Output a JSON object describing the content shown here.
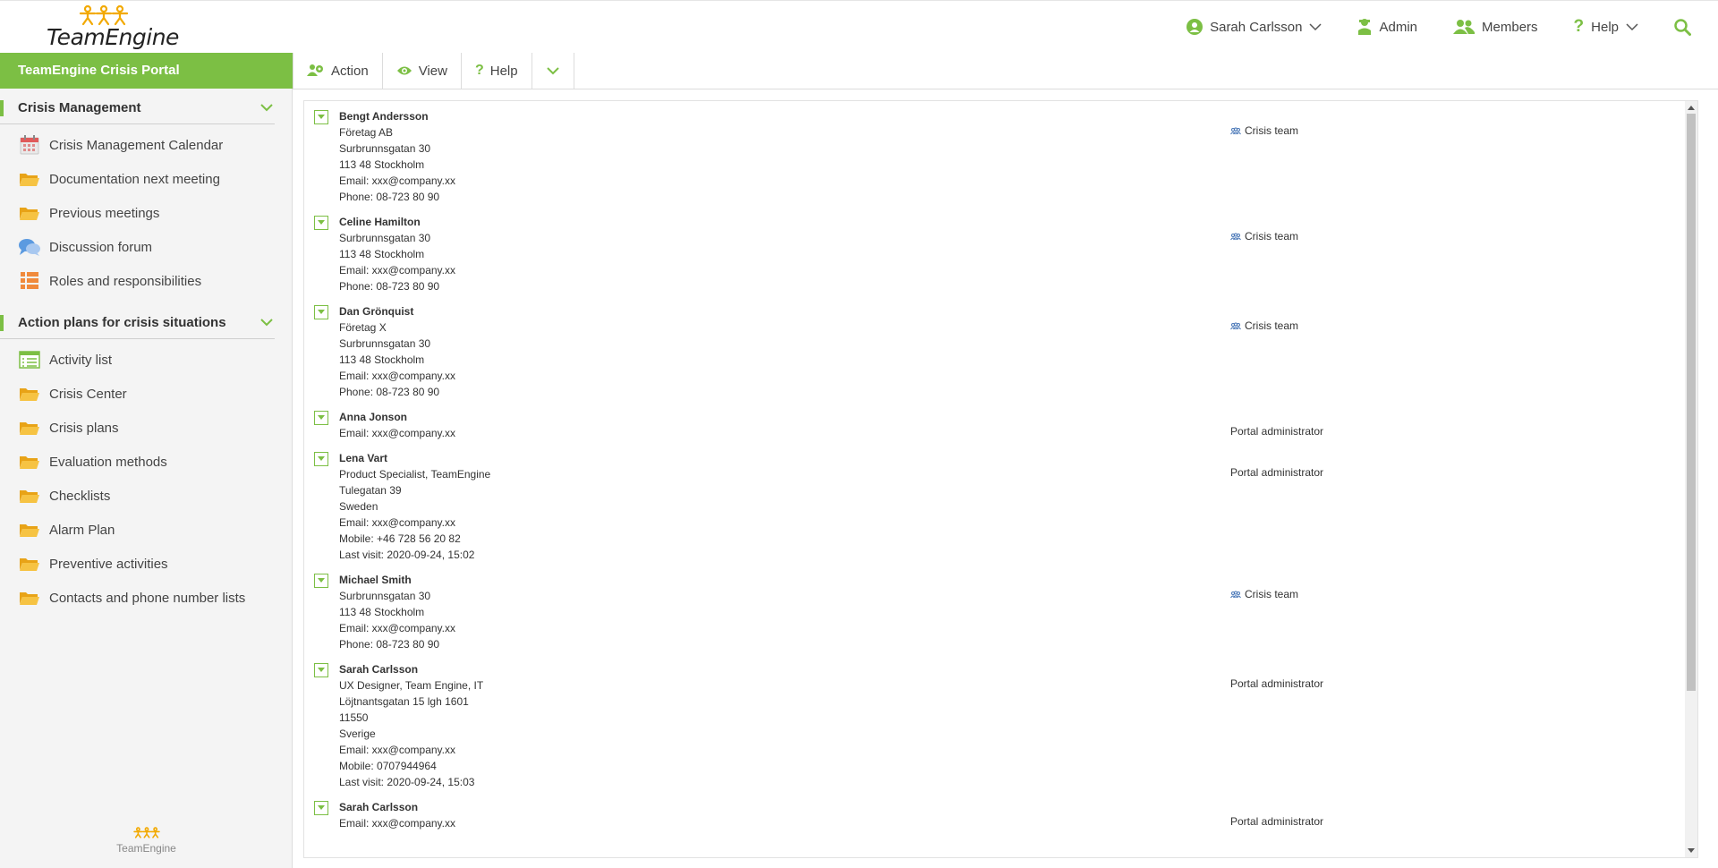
{
  "app": {
    "logo_text": "TeamEngine",
    "footer_logo_text": "TeamEngine",
    "accent_color": "#7cbf44"
  },
  "top_nav": {
    "user": "Sarah Carlsson",
    "admin": "Admin",
    "members": "Members",
    "help": "Help"
  },
  "portal_title": "TeamEngine Crisis Portal",
  "toolbar": {
    "action": "Action",
    "view": "View",
    "help": "Help"
  },
  "sidebar": {
    "sections": [
      {
        "title": "Crisis Management",
        "items": [
          {
            "label": "Crisis Management Calendar",
            "icon": "calendar-icon"
          },
          {
            "label": "Documentation next meeting",
            "icon": "folder-icon"
          },
          {
            "label": "Previous meetings",
            "icon": "folder-icon"
          },
          {
            "label": "Discussion forum",
            "icon": "forum-icon"
          },
          {
            "label": "Roles and responsibilities",
            "icon": "list-icon"
          }
        ]
      },
      {
        "title": "Action plans for crisis situations",
        "items": [
          {
            "label": "Activity list",
            "icon": "activity-list-icon"
          },
          {
            "label": "Crisis Center",
            "icon": "folder-icon"
          },
          {
            "label": "Crisis plans",
            "icon": "folder-icon"
          },
          {
            "label": "Evaluation methods",
            "icon": "folder-icon"
          },
          {
            "label": "Checklists",
            "icon": "folder-icon"
          },
          {
            "label": "Alarm Plan",
            "icon": "folder-icon"
          },
          {
            "label": "Preventive activities",
            "icon": "folder-icon"
          },
          {
            "label": "Contacts and phone number lists",
            "icon": "folder-icon"
          }
        ]
      }
    ]
  },
  "members": [
    {
      "name": "Bengt Andersson",
      "lines": [
        "Företag AB",
        "Surbrunnsgatan 30",
        "113 48 Stockholm",
        "Email: xxx@company.xx",
        "Phone: 08-723 80 90"
      ],
      "role": "Crisis team",
      "role_icon": true
    },
    {
      "name": "Celine Hamilton",
      "lines": [
        "Surbrunnsgatan 30",
        "113 48 Stockholm",
        "Email: xxx@company.xx",
        "Phone: 08-723 80 90"
      ],
      "role": "Crisis team",
      "role_icon": true
    },
    {
      "name": "Dan Grönquist",
      "lines": [
        "Företag X",
        "Surbrunnsgatan 30",
        "113 48 Stockholm",
        "Email: xxx@company.xx",
        "Phone: 08-723 80 90"
      ],
      "role": "Crisis team",
      "role_icon": true
    },
    {
      "name": "Anna Jonson",
      "lines": [
        "Email: xxx@company.xx"
      ],
      "role": "Portal administrator",
      "role_icon": false
    },
    {
      "name": "Lena Vart",
      "lines": [
        "Product Specialist, TeamEngine",
        "Tulegatan 39",
        "Sweden",
        "Email: xxx@company.xx",
        "Mobile: +46 728 56 20 82",
        "Last visit: 2020-09-24, 15:02"
      ],
      "role": "Portal administrator",
      "role_icon": false
    },
    {
      "name": "Michael Smith",
      "lines": [
        "Surbrunnsgatan 30",
        "113 48 Stockholm",
        "Email: xxx@company.xx",
        "Phone: 08-723 80 90"
      ],
      "role": "Crisis team",
      "role_icon": true
    },
    {
      "name": "Sarah Carlsson",
      "lines": [
        "UX Designer, Team Engine, IT",
        "Löjtnantsgatan 15 lgh 1601",
        "11550",
        "Sverige",
        "Email: xxx@company.xx",
        "Mobile: 0707944964",
        "Last visit: 2020-09-24, 15:03"
      ],
      "role": "Portal administrator",
      "role_icon": false
    },
    {
      "name": "Sarah Carlsson",
      "lines": [
        "Email: xxx@company.xx"
      ],
      "role": "Portal administrator",
      "role_icon": false
    }
  ]
}
